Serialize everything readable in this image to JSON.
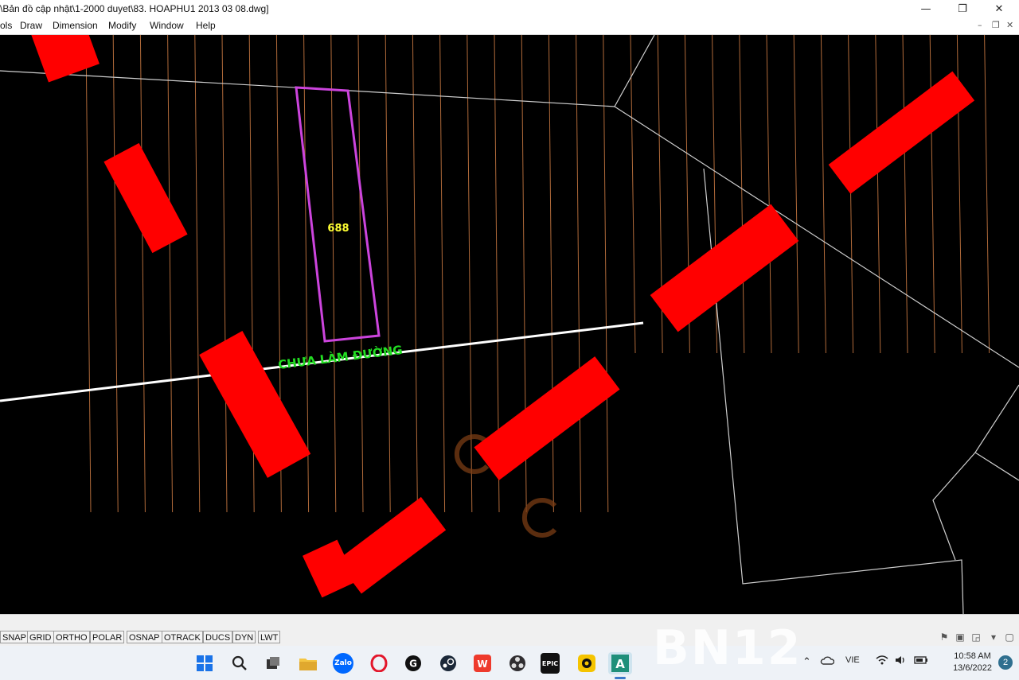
{
  "window": {
    "title": "\\Bản đồ cập nhật\\1-2000 duyet\\83. HOAPHU1 2013 03 08.dwg]",
    "minimize_icon": "minimize-icon",
    "restore_icon": "restore-icon",
    "close_icon": "close-icon"
  },
  "menu": {
    "items": [
      "ols",
      "Draw",
      "Dimension",
      "Modify",
      "Window",
      "Help"
    ]
  },
  "drawing": {
    "parcel_number": "688",
    "road_label": "CHƯA LÀM ĐƯỜNG",
    "colors": {
      "background": "#000000",
      "hatch": "#b06a3a",
      "parcel": "#cc44dd",
      "parcel_label": "#ffff33",
      "road_label": "#22dd22",
      "redaction": "#ff0000",
      "boundary": "#cfcfcf"
    }
  },
  "statusbar": {
    "toggles": [
      "SNAP",
      "GRID",
      "ORTHO",
      "POLAR",
      "OSNAP",
      "OTRACK",
      "DUCS",
      "DYN",
      "LWT"
    ]
  },
  "taskbar": {
    "apps": [
      "windows-start-icon",
      "search-icon",
      "task-view-icon",
      "file-explorer-icon",
      "zalo-icon",
      "opera-icon",
      "g-hub-icon",
      "steam-icon",
      "wps-office-icon",
      "obs-icon",
      "epic-games-icon",
      "screen-recorder-icon",
      "autocad-icon"
    ],
    "zalo_label": "Zalo",
    "epic_label": "EPIC",
    "language": "VIE",
    "time": "10:58 AM",
    "date": "13/6/2022",
    "notification_count": "2"
  },
  "watermark": "BN12"
}
